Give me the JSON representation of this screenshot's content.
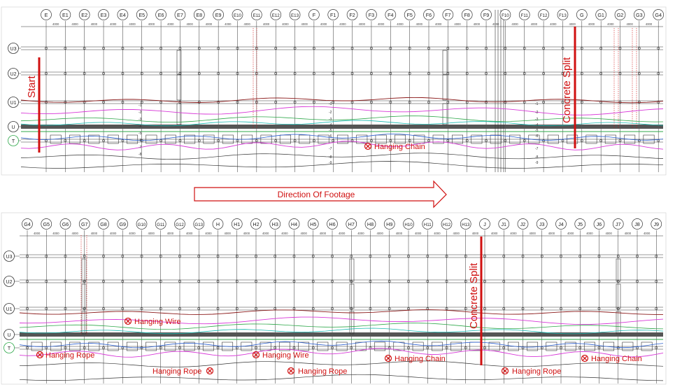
{
  "panel_top": {
    "grid_columns": [
      "E",
      "E1",
      "E2",
      "E3",
      "E4",
      "E5",
      "E6",
      "E7",
      "E8",
      "E9",
      "E10",
      "E11",
      "E12",
      "E13",
      "F",
      "F1",
      "F2",
      "F3",
      "F4",
      "F5",
      "F6",
      "F7",
      "F8",
      "F9",
      "F10",
      "F11",
      "F12",
      "F13",
      "G",
      "G1",
      "G2",
      "G3",
      "G4"
    ],
    "grid_rows": [
      "U3",
      "U2",
      "U1",
      "U",
      "T"
    ],
    "span_label": "4000",
    "contour_labels": [
      "-1",
      "-2",
      "-3",
      "-4",
      "-5",
      "-6",
      "-7",
      "-8",
      "-9"
    ],
    "start_label": "Start",
    "split_label": "Concrete Split",
    "annotations": [
      "Hanging Chain"
    ]
  },
  "direction_label": "Direction Of Footage",
  "panel_bottom": {
    "grid_columns": [
      "G4",
      "G5",
      "G6",
      "G7",
      "G8",
      "G9",
      "G10",
      "G11",
      "G12",
      "G13",
      "H",
      "H1",
      "H2",
      "H3",
      "H4",
      "H5",
      "H6",
      "H7",
      "H8",
      "H9",
      "H10",
      "H11",
      "H12",
      "H13",
      "J",
      "J1",
      "J2",
      "J3",
      "J4",
      "J5",
      "J6",
      "J7",
      "J8",
      "J9"
    ],
    "grid_rows": [
      "U3",
      "U2",
      "U1",
      "U",
      "T"
    ],
    "span_label": "4000",
    "split_label": "Concrete Split",
    "annotations": [
      "Hanging Wire",
      "Hanging Rope",
      "Hanging Wire",
      "Hanging Chain",
      "Hanging Chain",
      "Hanging Rope",
      "Hanging Rope",
      "Hanging Rope"
    ]
  },
  "colors": {
    "marker_red": "#d01010",
    "grid": "#333333",
    "contour_pink": "#d838d8",
    "contour_green": "#2ea84a",
    "contour_teal": "#18b8b0",
    "contour_blue": "#2a5fd0",
    "contour_dark_red": "#8b1a1a"
  }
}
